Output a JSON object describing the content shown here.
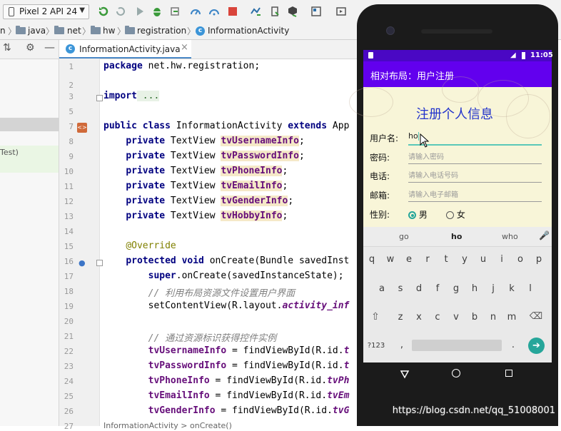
{
  "toolbar": {
    "device": "Pixel 2 API 24"
  },
  "breadcrumb": {
    "items": [
      "n",
      "java",
      "net",
      "hw",
      "registration",
      "InformationActivity"
    ]
  },
  "left_panel": {
    "item_text": "Test)"
  },
  "editor": {
    "tab_label": "InformationActivity.java",
    "tab_close": "×",
    "line_numbers": [
      "1",
      "2",
      "3",
      "5",
      "7",
      "8",
      "9",
      "10",
      "11",
      "12",
      "13",
      "14",
      "15",
      "16",
      "17",
      "18",
      "19",
      "20",
      "21",
      "22",
      "23",
      "24",
      "25",
      "26",
      "27"
    ],
    "code": {
      "l1_kw": "package",
      "l1_rest": " net.hw.registration;",
      "l3_kw": "import",
      "l3_fold": " ...",
      "l7_kw1": "public class",
      "l7_name": " InformationActivity ",
      "l7_kw2": "extends",
      "l7_rest": " App",
      "field_kw": "private",
      "field_type": " TextView ",
      "fields": [
        "tvUsernameInfo",
        "tvPasswordInfo",
        "tvPhoneInfo",
        "tvEmailInfo",
        "tvGenderInfo",
        "tvHobbyInfo"
      ],
      "semicolon": ";",
      "l16_ann": "@Override",
      "l17_kw": "protected void",
      "l17_rest": " onCreate(Bundle savedInst",
      "l18_kw": "super",
      "l18_rest": ".onCreate(savedInstanceState);",
      "l19_cmt": "// 利用布局资源文件设置用户界面",
      "l20_pre": "setContentView(R.layout.",
      "l20_it": "activity_inf",
      "l22_cmt": "// 通过资源标识获得控件实例",
      "l23_pre": " = findViewById(R.id.",
      "l23_it": "t",
      "l24_pre": " = findViewById(R.id.",
      "l24_it": "t",
      "l25_pre": " = findViewById(R.id.",
      "l25_it": "tvPh",
      "l26_pre": " = findViewById(R.id.",
      "l26_it": "tvEm",
      "l27_pre": " = findViewById(R.id.",
      "l27_it": "tvG"
    },
    "bottom_text": "InformationActivity > onCreate()"
  },
  "phone": {
    "time": "11:05",
    "app_title": "相对布局：用户注册",
    "form_title": "注册个人信息",
    "username_label": "用户名:",
    "username_value": "ho",
    "password_label": "密码:",
    "password_placeholder": "请输入密码",
    "phone_label": "电话:",
    "phone_placeholder": "请输入电话号码",
    "email_label": "邮箱:",
    "email_placeholder": "请输入电子邮箱",
    "gender_label": "性别:",
    "gender_male": "男",
    "gender_female": "女",
    "suggestions": [
      "go",
      "ho",
      "who"
    ],
    "row1": [
      "q",
      "w",
      "e",
      "r",
      "t",
      "y",
      "u",
      "i",
      "o",
      "p"
    ],
    "row2": [
      "a",
      "s",
      "d",
      "f",
      "g",
      "h",
      "j",
      "k",
      "l"
    ],
    "row3": [
      "z",
      "x",
      "c",
      "v",
      "b",
      "n",
      "m"
    ],
    "sym_key": "?123",
    "comma_key": ",",
    "period_key": "."
  },
  "watermark": "https://blog.csdn.net/qq_51008001"
}
